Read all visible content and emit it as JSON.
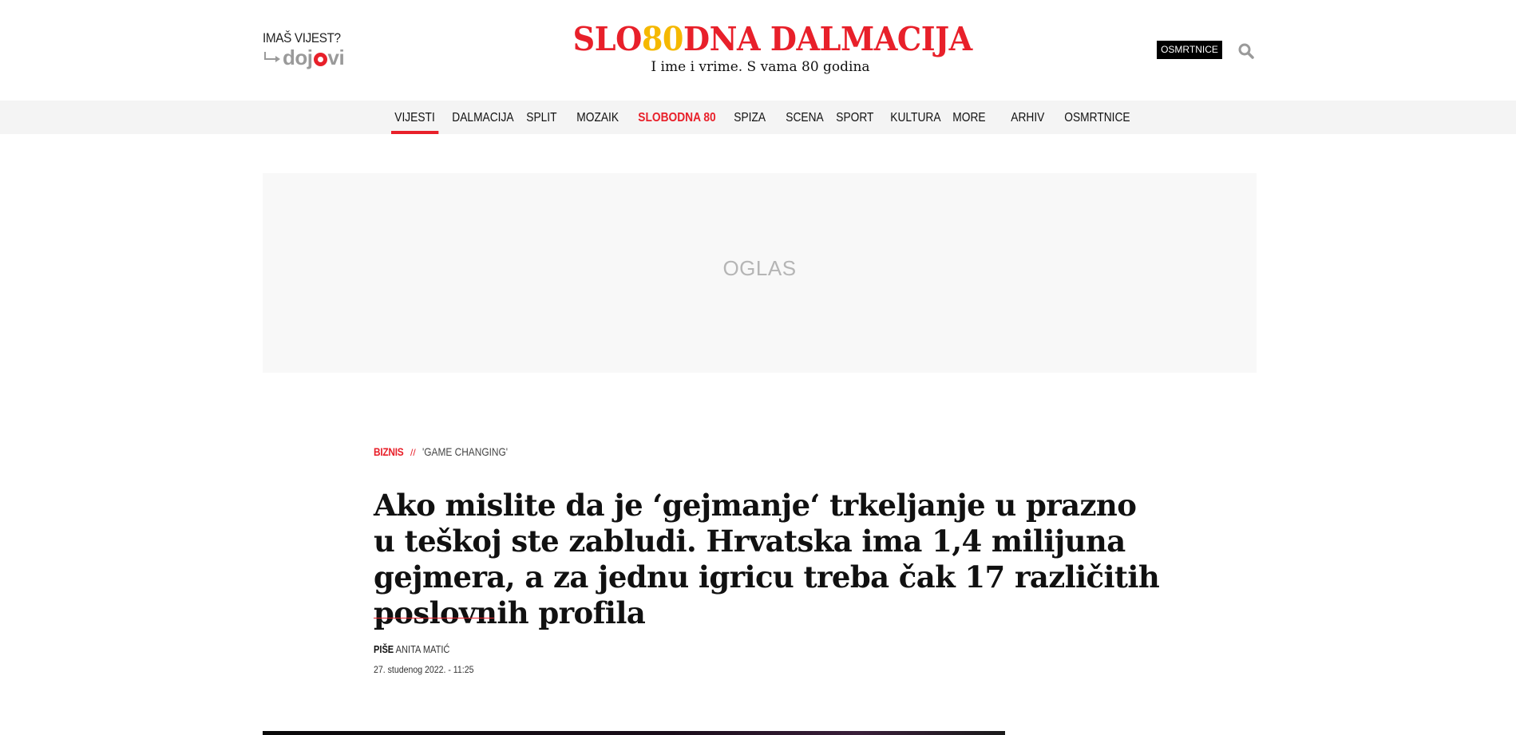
{
  "header": {
    "tip_prompt": "IMAŠ VIJEST?",
    "tip_brand_pre": "doj",
    "tip_brand_post": "vi",
    "logo_part1": "SLO",
    "logo_part2": "80",
    "logo_part3": "DNA DALMACIJA",
    "tagline": "I ime i vrime. S vama 80 godina",
    "osmrtnice_label": "OSMRTNICE",
    "search_icon": "search-icon",
    "accent_color": "#e8202a",
    "anniversary_color": "#f5b800"
  },
  "nav": {
    "items": [
      {
        "label": "VIJESTI",
        "active": true
      },
      {
        "label": "DALMACIJA"
      },
      {
        "label": "SPLIT"
      },
      {
        "label": "MOZAIK"
      },
      {
        "label": "SLOBODNA 80",
        "highlight": true
      },
      {
        "label": "SPIZA"
      },
      {
        "label": "SCENA"
      },
      {
        "label": "SPORT"
      },
      {
        "label": "KULTURA"
      },
      {
        "label": "MORE"
      },
      {
        "label": "ARHIV"
      },
      {
        "label": "OSMRTNICE"
      }
    ]
  },
  "ad": {
    "label": "OGLAS"
  },
  "article": {
    "category": "BIZNIS",
    "separator": "//",
    "subtitle": "'GAME CHANGING'",
    "title": "Ako mislite da je ‘gejmanje‘ trkeljanje u prazno u teškoj ste zabludi. Hrvatska ima 1,4 milijuna gejmera, a za jednu igricu treba čak 17 različitih poslovnih profila",
    "byline_prefix": "PIŠE",
    "author": "ANITA MATIĆ",
    "date": "27. studenog 2022. - 11:25"
  }
}
